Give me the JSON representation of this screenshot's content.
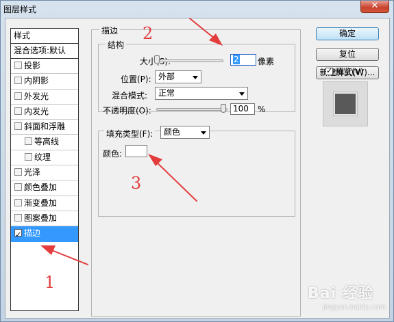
{
  "window": {
    "title": "图层样式",
    "close_glyph": "✕"
  },
  "sidebar": {
    "header": "样式",
    "blend_options": "混合选项:默认",
    "items": [
      {
        "label": "投影",
        "checked": false,
        "sub": false
      },
      {
        "label": "内阴影",
        "checked": false,
        "sub": false
      },
      {
        "label": "外发光",
        "checked": false,
        "sub": false
      },
      {
        "label": "内发光",
        "checked": false,
        "sub": false
      },
      {
        "label": "斜面和浮雕",
        "checked": false,
        "sub": false
      },
      {
        "label": "等高线",
        "checked": false,
        "sub": true
      },
      {
        "label": "纹理",
        "checked": false,
        "sub": true
      },
      {
        "label": "光泽",
        "checked": false,
        "sub": false
      },
      {
        "label": "颜色叠加",
        "checked": false,
        "sub": false
      },
      {
        "label": "渐变叠加",
        "checked": false,
        "sub": false
      },
      {
        "label": "图案叠加",
        "checked": false,
        "sub": false
      },
      {
        "label": "描边",
        "checked": true,
        "sub": false,
        "selected": true
      }
    ]
  },
  "stroke": {
    "group_title": "描边",
    "structure_title": "结构",
    "size_label": "大小(S):",
    "size_value": "2",
    "size_unit": "像素",
    "position_label": "位置(P):",
    "position_value": "外部",
    "blend_mode_label": "混合模式:",
    "blend_mode_value": "正常",
    "opacity_label": "不透明度(O):",
    "opacity_value": "100",
    "opacity_unit": "%",
    "fill_type_label": "填充类型(F):",
    "fill_type_value": "颜色",
    "color_label": "颜色:",
    "color_value": "#ffffff"
  },
  "actions": {
    "ok": "确定",
    "reset": "复位",
    "new_style": "新建样式(W)...",
    "preview_label": "预览(V)",
    "preview_checked": true
  },
  "annotations": {
    "one": "1",
    "two": "2",
    "three": "3",
    "color": "#e23c3c"
  },
  "watermark": {
    "main": "Bai 经验",
    "sub": "jingyan.baidu.com"
  }
}
